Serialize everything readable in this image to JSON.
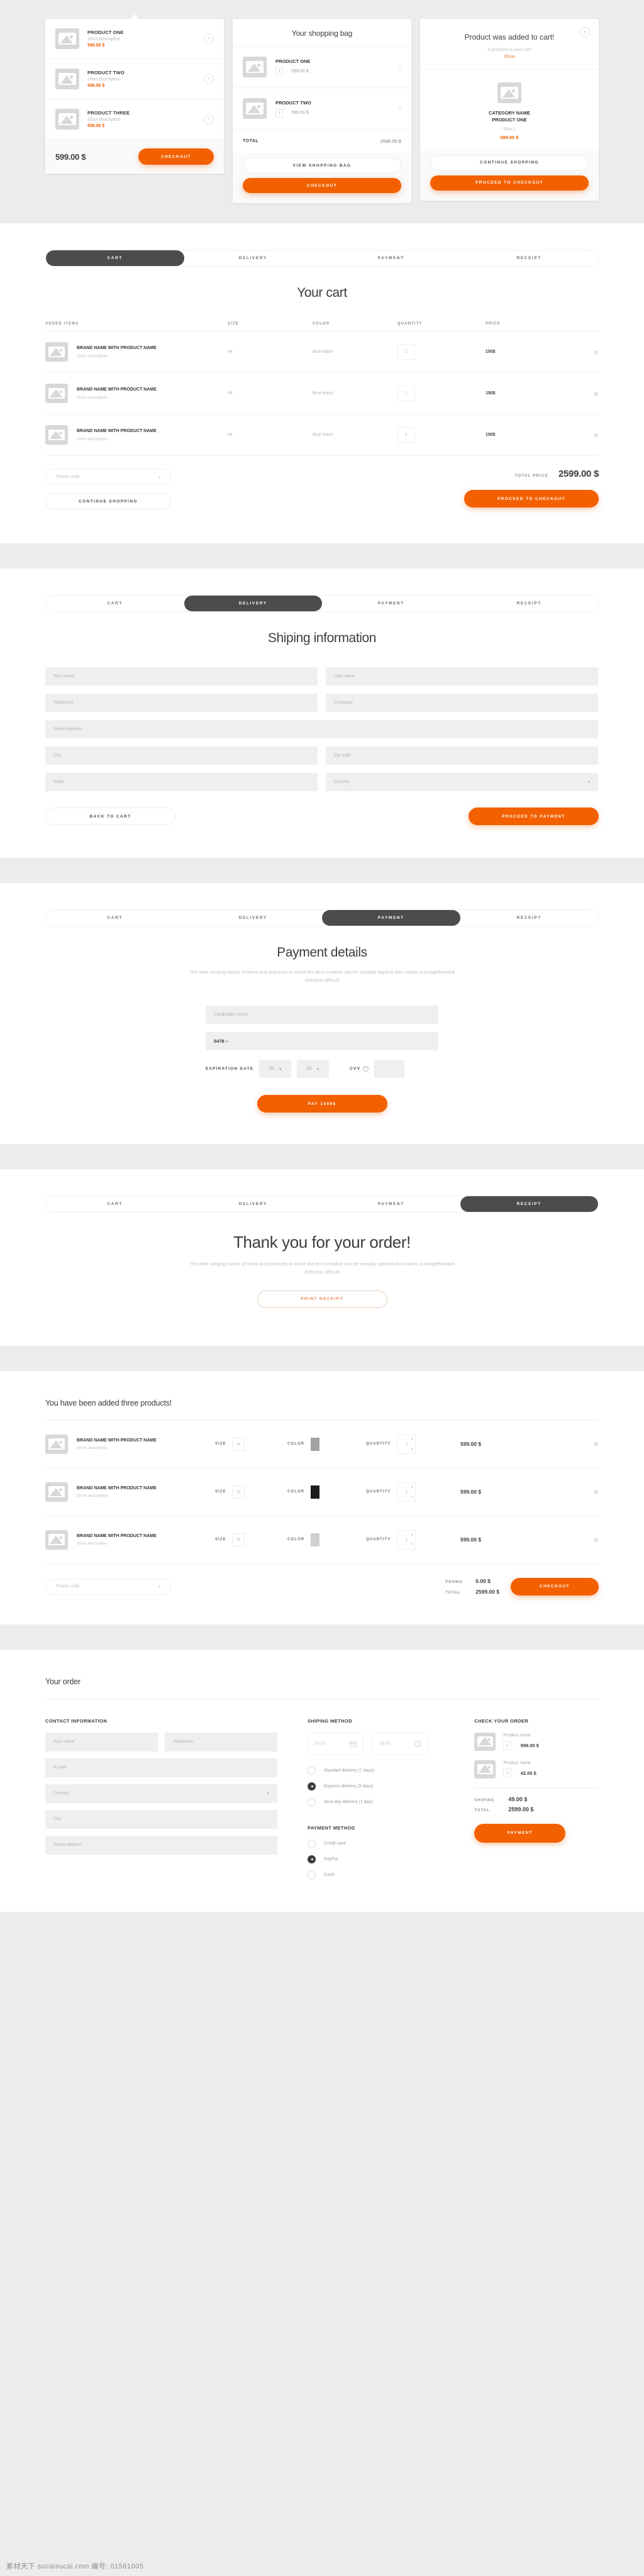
{
  "theme": {
    "orange": "#f26000",
    "dark": "#4c4c4c",
    "muted": "#b6b6b6",
    "field_bg": "#efefef"
  },
  "mini_cart": {
    "items": [
      {
        "title": "PRODUCT ONE",
        "desc": "Short description",
        "price": "599.00 $",
        "close": "×"
      },
      {
        "title": "PRODUCT TWO",
        "desc": "Short description",
        "price": "599.00 $",
        "close": "×"
      },
      {
        "title": "PRODUCT THREE",
        "desc": "Short description",
        "price": "599.00 $",
        "close": "×"
      }
    ],
    "total": "599.00 $",
    "checkout_label": "CHECKOUT"
  },
  "shopping_bag": {
    "title": "Your shopping bag",
    "items": [
      {
        "name": "PRODUCT ONE",
        "qty": "1",
        "sep": "·",
        "price": "599.00 $",
        "close": "×"
      },
      {
        "name": "PRODUCT TWO",
        "qty": "1",
        "sep": "·",
        "price": "599.00 $",
        "close": "×"
      }
    ],
    "total_label": "TOTAL",
    "total_value": "2599.00 $",
    "view_bag_label": "VIEW SHOPPING BAG",
    "checkout_label": "CHECKOUT"
  },
  "added_popup": {
    "close": "×",
    "title": "Product was added to cart!",
    "subtitle": "5 products in your cart",
    "show_link": "Show",
    "product_line1": "CATEGORY NAME",
    "product_line2": "PRODUCT ONE",
    "size": "Size L",
    "price": "599.00 $",
    "continue_label": "CONTINUE SHOPPING",
    "proceed_label": "PROCEED TO CHECKOUT"
  },
  "steps": {
    "cart": "CART",
    "delivery": "DELIVERY",
    "payment": "PAYMENT",
    "receipt": "RECEIPT"
  },
  "cart_page": {
    "title": "Your cart",
    "columns": {
      "items": "ADDED ITEMS",
      "size": "SIZE",
      "color": "COLOR",
      "quantity": "QUANTITY",
      "price": "PRICE"
    },
    "rows": [
      {
        "name": "BRAND NAME WITH PRODUCT NAME",
        "desc": "Short description",
        "size": "44",
        "color": "Blue-black",
        "qty": "1",
        "price": "150$",
        "remove": "✕"
      },
      {
        "name": "BRAND NAME WITH PRODUCT NAME",
        "desc": "Short description",
        "size": "44",
        "color": "Blue-black",
        "qty": "1",
        "price": "150$",
        "remove": "✕"
      },
      {
        "name": "BRAND NAME WITH PRODUCT NAME",
        "desc": "Short description",
        "size": "44",
        "color": "Blue-black",
        "qty": "1",
        "price": "150$",
        "remove": "✕"
      }
    ],
    "promo_placeholder": "Promo code",
    "promo_arrow": "›",
    "continue_label": "CONTINUE SHOPPING",
    "total_label": "TOTAL PRICE",
    "total_value": "2599.00 $",
    "proceed_label": "PROCEED TO CHECKOUT"
  },
  "shipping_page": {
    "title": "Shiping information",
    "fields": {
      "first_name": "First name",
      "last_name": "Last name",
      "telephone": "Telephone",
      "company": "Company",
      "street": "Street address",
      "city": "City",
      "zip": "Zip code",
      "state": "State",
      "country": "Country",
      "country_caret": "▾"
    },
    "back_label": "BACK TO CART",
    "proceed_label": "PROCEED TO PAYMENT"
  },
  "payment_page": {
    "title": "Payment details",
    "subtitle": "The wide ranging nature of items and practices to which the term creative can be sensibly applied also makes a straightforward definition difficult",
    "cardholder_placeholder": "Cardholder name",
    "card_number": "5478 –",
    "expiration_label": "EXPIRATION DATE",
    "month": "01",
    "year": "01",
    "select_caret": "▾",
    "cvv_label": "CVV",
    "cvv_help": "?",
    "pay_label": "PAY 1499$"
  },
  "receipt_page": {
    "title": "Thank you for your order!",
    "subtitle": "The wide ranging nature of items and practices to which the term creative can be sensibly applied also makes a straightforward definition difficult",
    "print_label": "PRINT RECEIPT"
  },
  "added_products": {
    "title": "You have been added three products!",
    "labels": {
      "size": "SIZE",
      "color": "COLOR",
      "quantity": "QUANTITY"
    },
    "rows": [
      {
        "name": "BRAND NAME WITH PRODUCT NAME",
        "desc": "Short description",
        "size": "M",
        "color_hex": "#a3a3a3",
        "qty": "1",
        "price": "599.00 $",
        "remove": "✕"
      },
      {
        "name": "BRAND NAME WITH PRODUCT NAME",
        "desc": "Short description",
        "size": "M",
        "color_hex": "#1d1d1d",
        "qty": "1",
        "price": "599.00 $",
        "remove": "✕"
      },
      {
        "name": "BRAND NAME WITH PRODUCT NAME",
        "desc": "Short description",
        "size": "M",
        "color_hex": "#cfcfcf",
        "qty": "1",
        "price": "599.00 $",
        "remove": "✕"
      }
    ],
    "promo_placeholder": "Promo code",
    "promo_arrow": "›",
    "promo_label": "PROMO",
    "promo_value": "0.00 $",
    "total_label": "TOTAL",
    "total_value": "2599.00 $",
    "checkout_label": "CHECKOUT"
  },
  "order_page": {
    "title": "Your order",
    "contact": {
      "heading": "CONTACT INFORMATION",
      "name": "Your name",
      "telephone": "Telephone",
      "email": "E-mail",
      "country": "Country",
      "country_caret": "▾",
      "city": "City",
      "street": "Street address"
    },
    "shipping": {
      "heading": "SHIPING METHOD",
      "date": "14.12",
      "time": "16:00",
      "options": [
        {
          "label": "Standart delivery (7 days)",
          "selected": false
        },
        {
          "label": "Express delivery (3 days)",
          "selected": true
        },
        {
          "label": "Next day delivery (1 day)",
          "selected": false
        }
      ]
    },
    "payment": {
      "heading": "PAYMENT METHOD",
      "options": [
        {
          "label": "Credit card",
          "selected": false
        },
        {
          "label": "PayPal",
          "selected": true
        },
        {
          "label": "Cash",
          "selected": false
        }
      ]
    },
    "check": {
      "heading": "CHECK YOUR ORDER",
      "items": [
        {
          "name": "Product name",
          "qty": "1",
          "sep": "·",
          "price": "599.00 $"
        },
        {
          "name": "Product name",
          "qty": "1",
          "sep": "·",
          "price": "42.00 $"
        }
      ],
      "shipping_label": "SHIPING",
      "shipping_value": "49.00 $",
      "total_label": "TOTAL",
      "total_value": "2599.00 $",
      "payment_label": "PAYMENT"
    }
  },
  "watermark": "素材天下 sucaisucai.com  编号: 01561005"
}
